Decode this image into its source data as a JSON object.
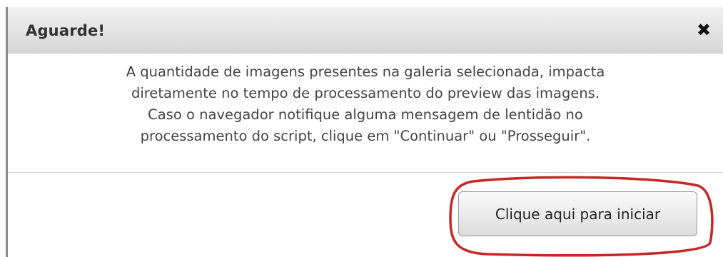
{
  "dialog": {
    "title": "Aguarde!",
    "close_icon": "close-icon",
    "message_lines": [
      "A quantidade de imagens presentes na galeria selecionada, impacta",
      "diretamente no tempo de processamento do preview das imagens.",
      "Caso o navegador notifique alguma mensagem de lentidão no",
      "processamento do script, clique em \"Continuar\" ou \"Prosseguir\"."
    ],
    "start_button_label": "Clique aqui para iniciar"
  },
  "colors": {
    "highlight": "#c62828",
    "title_text": "#333333",
    "body_text": "#444444"
  }
}
